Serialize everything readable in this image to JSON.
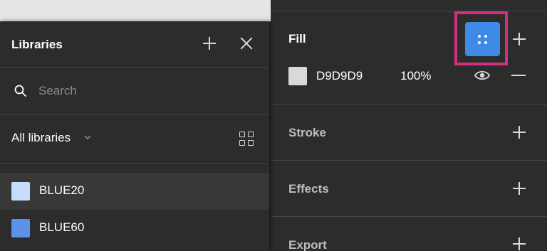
{
  "libraries": {
    "title": "Libraries",
    "search": {
      "placeholder": "Search",
      "value": ""
    },
    "filter_label": "All libraries",
    "items": [
      {
        "label": "BLUE20",
        "color": "#c7dcfb"
      },
      {
        "label": "BLUE60",
        "color": "#5b92ea"
      }
    ]
  },
  "properties": {
    "fill": {
      "title": "Fill",
      "hex": "D9D9D9",
      "opacity": "100%",
      "swatch_color": "#d9d9d9",
      "style_button_color": "#3d8be6"
    },
    "sections": [
      {
        "title": "Stroke"
      },
      {
        "title": "Effects"
      },
      {
        "title": "Export"
      }
    ]
  },
  "colors": {
    "panel_bg": "#2c2c2c",
    "highlight": "#d1317c"
  }
}
